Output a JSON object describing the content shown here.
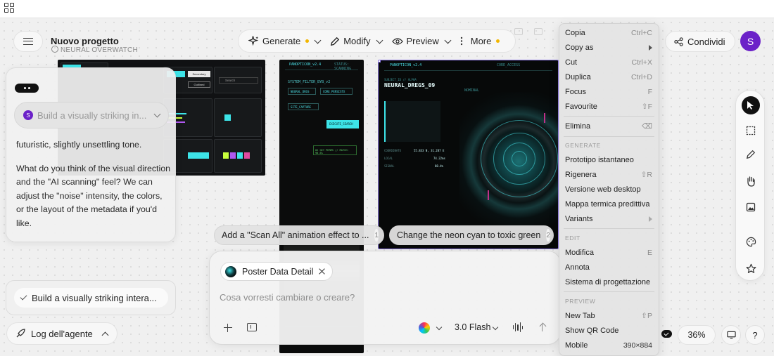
{
  "project": {
    "title": "Nuovo progetto",
    "subtitle": "NEURAL OVERWATCH"
  },
  "toolbar": {
    "generate": "Generate",
    "modify": "Modify",
    "preview": "Preview",
    "more": "More"
  },
  "share_label": "Condividi",
  "avatar_initial": "S",
  "screens": {
    "shot1": {
      "cells": [
        "Primary",
        "Secondary",
        "Outlined",
        "Search"
      ]
    },
    "shot2": {
      "title": "PANOPTICON_v2.4",
      "status": "STATUS: SCANNING",
      "filter": "SYSTEM_FILTER_BYB_v2",
      "chip1": "NEURAL_DRGS",
      "chip2": "CORE_PERSISTX",
      "chip3": "SITE_CAPTURE",
      "button": "EXECUTE_SEARCH",
      "alert": "02 GEY PERMS // MATCH: 98.6%"
    },
    "shot3": {
      "title": "PANOPTICON_v2.4",
      "header_right": "CORE_ACCESS",
      "subject": "NEURAL_DREGS_09",
      "tag": "SUBJECT_ID // ALPHA",
      "status": "NOMINAL",
      "r1_label": "COORDINATE",
      "r1_val": "55.833 N, 31.287 E",
      "r2_label": "LOCAL",
      "r2_val": "74.22ms",
      "r3_label": "SIGNAL",
      "r3_val": "88.4%"
    }
  },
  "chat": {
    "prompt_preview": "Build a visually striking in...",
    "message_tail": "futuristic, slightly unsettling tone.",
    "message": "What do you think of the visual direction and the \"AI scanning\" feel? We can adjust the \"noise\" intensity, the colors, or the layout of the metadata if you'd like.",
    "user_message": "Build a visually striking intera...",
    "log_label": "Log dell'agente"
  },
  "suggestions": [
    {
      "text": "Add a \"Scan All\" animation effect to ...",
      "num": "1"
    },
    {
      "text": "Change the neon cyan to toxic green",
      "num": "2"
    }
  ],
  "composer": {
    "chip_label": "Poster Data Detail",
    "placeholder": "Cosa vorresti cambiare o creare?",
    "model": "3.0 Flash"
  },
  "context_menu": {
    "items_top": [
      {
        "label": "Copia",
        "shortcut": "Ctrl+C"
      },
      {
        "label": "Copy as",
        "shortcut": ""
      },
      {
        "label": "Cut",
        "shortcut": "Ctrl+X"
      },
      {
        "label": "Duplica",
        "shortcut": "Ctrl+D"
      },
      {
        "label": "Focus",
        "shortcut": "F"
      },
      {
        "label": "Favourite",
        "shortcut": "⇧F"
      }
    ],
    "delete": {
      "label": "Elimina",
      "shortcut": "⌫"
    },
    "section_generate": "GENERATE",
    "items_generate": [
      {
        "label": "Prototipo istantaneo",
        "shortcut": ""
      },
      {
        "label": "Rigenera",
        "shortcut": "⇧R"
      },
      {
        "label": "Versione web desktop",
        "shortcut": ""
      },
      {
        "label": "Mappa termica predittiva",
        "shortcut": ""
      },
      {
        "label": "Variants",
        "shortcut": ""
      }
    ],
    "section_edit": "EDIT",
    "items_edit": [
      {
        "label": "Modifica",
        "shortcut": "E"
      },
      {
        "label": "Annota",
        "shortcut": ""
      },
      {
        "label": "Sistema di progettazione",
        "shortcut": ""
      }
    ],
    "section_preview": "PREVIEW",
    "items_preview": [
      {
        "label": "New Tab",
        "shortcut": "⇧P"
      },
      {
        "label": "Show QR Code",
        "shortcut": ""
      },
      {
        "label": "Mobile",
        "shortcut": "390×884"
      }
    ]
  },
  "zoom": "36%",
  "help": "?"
}
